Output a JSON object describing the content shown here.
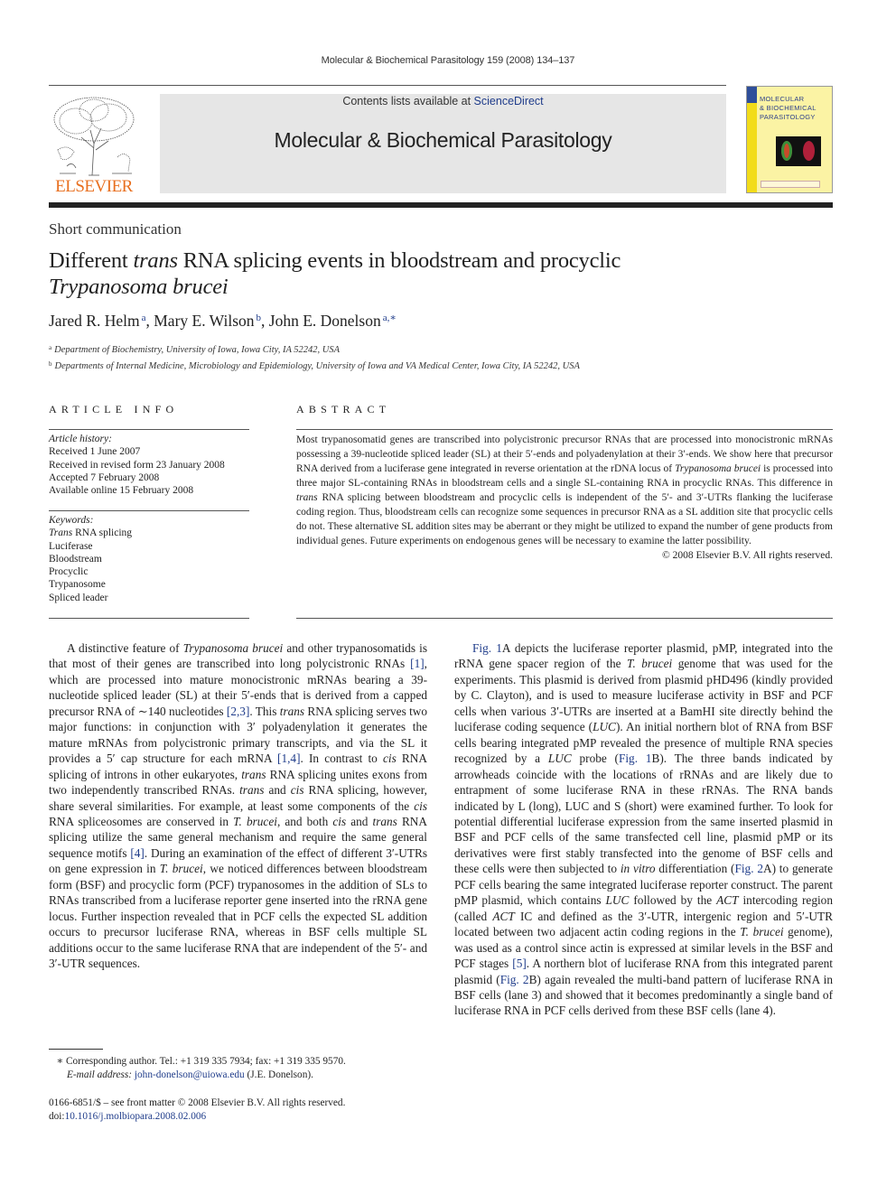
{
  "running_head": "Molecular & Biochemical Parasitology 159 (2008) 134–137",
  "masthead": {
    "publisher_logo": "ELSEVIER",
    "contents_prefix": "Contents lists available at ",
    "contents_link": "ScienceDirect",
    "journal_name": "Molecular & Biochemical Parasitology",
    "cover_title_lines": [
      "MOLECULAR",
      "& BIOCHEMICAL",
      "PARASITOLOGY"
    ]
  },
  "article": {
    "section_type": "Short communication",
    "title_part1": "Different ",
    "title_italic1": "trans",
    "title_part2": " RNA splicing events in bloodstream and procyclic",
    "title_italic2": "Trypanosoma brucei",
    "authors": [
      {
        "name": "Jared R. Helm",
        "sup": "a"
      },
      {
        "name": "Mary E. Wilson",
        "sup": "b"
      },
      {
        "name": "John E. Donelson",
        "sup": "a,∗"
      }
    ],
    "affiliations": [
      {
        "mark": "a",
        "text": "Department of Biochemistry, University of Iowa, Iowa City, IA 52242, USA"
      },
      {
        "mark": "b",
        "text": "Departments of Internal Medicine, Microbiology and Epidemiology, University of Iowa and VA Medical Center, Iowa City, IA 52242, USA"
      }
    ]
  },
  "article_info": {
    "heading": "ARTICLE INFO",
    "history_label": "Article history:",
    "history": [
      "Received 1 June 2007",
      "Received in revised form 23 January 2008",
      "Accepted 7 February 2008",
      "Available online 15 February 2008"
    ],
    "keywords_label": "Keywords:",
    "keyword_first_italic": "Trans",
    "keyword_first_rest": " RNA splicing",
    "keywords": [
      "Luciferase",
      "Bloodstream",
      "Procyclic",
      "Trypanosome",
      "Spliced leader"
    ]
  },
  "abstract": {
    "heading": "ABSTRACT",
    "p1": "Most trypanosomatid genes are transcribed into polycistronic precursor RNAs that are processed into monocistronic mRNAs possessing a 39-nucleotide spliced leader (SL) at their 5′-ends and polyadenylation at their 3′-ends. We show here that precursor RNA derived from a luciferase gene integrated in reverse orientation at the rDNA locus of ",
    "i1": "Trypanosoma brucei",
    "p2": " is processed into three major SL-containing RNAs in bloodstream cells and a single SL-containing RNA in procyclic RNAs. This difference in ",
    "i2": "trans",
    "p3": " RNA splicing between bloodstream and procyclic cells is independent of the 5′- and 3′-UTRs flanking the luciferase coding region. Thus, bloodstream cells can recognize some sequences in precursor RNA as a SL addition site that procyclic cells do not. These alternative SL addition sites may be aberrant or they might be utilized to expand the number of gene products from individual genes. Future experiments on endogenous genes will be necessary to examine the latter possibility.",
    "copyright": "© 2008 Elsevier B.V. All rights reserved."
  },
  "body_left": {
    "s1": "A distinctive feature of ",
    "i1": "Trypanosoma brucei",
    "s2": " and other trypanosomatids is that most of their genes are transcribed into long polycistronic RNAs ",
    "r1": "[1]",
    "s3": ", which are processed into mature monocistronic mRNAs bearing a 39-nucleotide spliced leader (SL) at their 5′-ends that is derived from a capped precursor RNA of ∼140 nucleotides ",
    "r2": "[2,3]",
    "s4": ". This ",
    "i2": "trans",
    "s5": " RNA splicing serves two major functions: in conjunction with 3′ polyadenylation it generates the mature mRNAs from polycistronic primary transcripts, and via the SL it provides a 5′ cap structure for each mRNA ",
    "r3": "[1,4]",
    "s6": ". In contrast to ",
    "i3": "cis",
    "s7": " RNA splicing of introns in other eukaryotes, ",
    "i4": "trans",
    "s8": " RNA splicing unites exons from two independently transcribed RNAs. ",
    "i5": "trans",
    "s9": " and ",
    "i6": "cis",
    "s10": " RNA splicing, however, share several similarities. For example, at least some components of the ",
    "i7": "cis",
    "s11": " RNA spliceosomes are conserved in ",
    "i8": "T. brucei",
    "s12": ", and both ",
    "i9": "cis",
    "s13": " and ",
    "i10": "trans",
    "s14": " RNA splicing utilize the same general mechanism and require the same general sequence motifs ",
    "r4": "[4]",
    "s15": ". During an examination of the effect of different 3′-UTRs on gene expression in ",
    "i11": "T. brucei",
    "s16": ", we noticed differences between bloodstream form (BSF) and procyclic form (PCF) trypanosomes in the addition of SLs to RNAs transcribed from a luciferase reporter gene inserted into the rRNA gene locus. Further inspection revealed that in PCF cells the expected SL addition occurs to precursor luciferase RNA, whereas in BSF cells multiple SL additions occur to the same luciferase RNA that are independent of the 5′- and 3′-UTR sequences."
  },
  "body_right": {
    "r1": "Fig. 1",
    "s1": "A depicts the luciferase reporter plasmid, pMP, integrated into the rRNA gene spacer region of the ",
    "i1": "T. brucei",
    "s2": " genome that was used for the experiments. This plasmid is derived from plasmid pHD496 (kindly provided by C. Clayton), and is used to measure luciferase activity in BSF and PCF cells when various 3′-UTRs are inserted at a BamHI site directly behind the luciferase coding sequence (",
    "i2": "LUC",
    "s3": "). An initial northern blot of RNA from BSF cells bearing integrated pMP revealed the presence of multiple RNA species recognized by a ",
    "i3": "LUC",
    "s4": " probe (",
    "r2": "Fig. 1",
    "s5": "B). The three bands indicated by arrowheads coincide with the locations of rRNAs and are likely due to entrapment of some luciferase RNA in these rRNAs. The RNA bands indicated by L (long), LUC and S (short) were examined further. To look for potential differential luciferase expression from the same inserted plasmid in BSF and PCF cells of the same transfected cell line, plasmid pMP or its derivatives were first stably transfected into the genome of BSF cells and these cells were then subjected to ",
    "i4": "in vitro",
    "s6": " differentiation (",
    "r3": "Fig. 2",
    "s7": "A) to generate PCF cells bearing the same integrated luciferase reporter construct. The parent pMP plasmid, which contains ",
    "i5": "LUC",
    "s8": " followed by the ",
    "i6": "ACT",
    "s9": " intercoding region (called ",
    "i7": "ACT",
    "s10": " IC and defined as the 3′-UTR, intergenic region and 5′-UTR located between two adjacent actin coding regions in the ",
    "i8": "T. brucei",
    "s11": " genome), was used as a control since actin is expressed at similar levels in the BSF and PCF stages ",
    "r4": "[5]",
    "s12": ". A northern blot of luciferase RNA from this integrated parent plasmid (",
    "r5": "Fig. 2",
    "s13": "B) again revealed the multi-band pattern of luciferase RNA in BSF cells (lane 3) and showed that it becomes predominantly a single band of luciferase RNA in PCF cells derived from these BSF cells (lane 4)."
  },
  "footnote": {
    "mark": "∗",
    "corresponding": " Corresponding author. Tel.: +1 319 335 7934; fax: +1 319 335 9570.",
    "email_label": "E-mail address:",
    "email": "john-donelson@uiowa.edu",
    "email_suffix": " (J.E. Donelson)."
  },
  "front_matter": {
    "issn_line": "0166-6851/$ – see front matter © 2008 Elsevier B.V. All rights reserved.",
    "doi_prefix": "doi:",
    "doi": "10.1016/j.molbiopara.2008.02.006"
  }
}
